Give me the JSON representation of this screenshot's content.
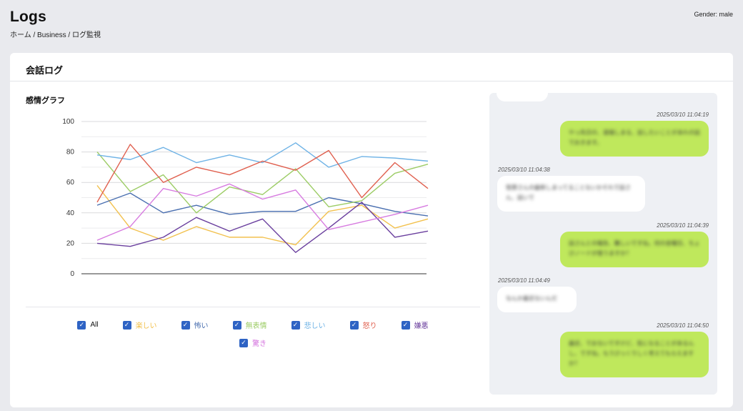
{
  "header": {
    "title": "Logs",
    "breadcrumb": "ホーム / Business / ログ監視",
    "gender": "Gender: male"
  },
  "card": {
    "title": "会話ログ",
    "chart_title": "感情グラフ"
  },
  "legend": {
    "all_label": "All",
    "items": [
      {
        "label": "楽しい",
        "color": "#f2c14e"
      },
      {
        "label": "怖い",
        "color": "#4a6fb0"
      },
      {
        "label": "無表情",
        "color": "#9ccc65"
      },
      {
        "label": "悲しい",
        "color": "#6fb3e6"
      },
      {
        "label": "怒り",
        "color": "#e0604f"
      },
      {
        "label": "嫌悪",
        "color": "#6a3f9e"
      },
      {
        "label": "驚き",
        "color": "#d77be0"
      }
    ]
  },
  "chart_data": {
    "type": "line",
    "x": [
      1,
      2,
      3,
      4,
      5,
      6,
      7,
      8,
      9,
      10,
      11,
      12
    ],
    "ylim": [
      0,
      100
    ],
    "yticks": [
      0,
      20,
      40,
      60,
      80,
      100
    ],
    "grid": true,
    "legend_position": "bottom",
    "series": [
      {
        "name": "楽しい",
        "color": "#f2c14e",
        "values": [
          58,
          30,
          22,
          31,
          24,
          24,
          19,
          41,
          45,
          30,
          36
        ]
      },
      {
        "name": "怖い",
        "color": "#4a6fb0",
        "values": [
          45,
          53,
          40,
          45,
          39,
          41,
          41,
          50,
          46,
          41,
          38
        ]
      },
      {
        "name": "無表情",
        "color": "#9ccc65",
        "values": [
          80,
          54,
          65,
          40,
          57,
          52,
          69,
          44,
          48,
          66,
          72
        ]
      },
      {
        "name": "悲しい",
        "color": "#6fb3e6",
        "values": [
          78,
          75,
          83,
          73,
          78,
          73,
          86,
          70,
          77,
          76,
          74
        ]
      },
      {
        "name": "怒り",
        "color": "#e0604f",
        "values": [
          47,
          85,
          60,
          70,
          65,
          74,
          68,
          81,
          50,
          73,
          56
        ]
      },
      {
        "name": "嫌悪",
        "color": "#6a3f9e",
        "values": [
          20,
          18,
          24,
          37,
          28,
          36,
          14,
          30,
          47,
          24,
          28
        ]
      },
      {
        "name": "驚き",
        "color": "#d77be0",
        "values": [
          22,
          31,
          56,
          51,
          59,
          49,
          55,
          29,
          34,
          39,
          45
        ]
      }
    ]
  },
  "chat": {
    "messages": [
      {
        "side": "me",
        "timestamp": "2025/03/10 11:04:19",
        "text": "やっ先日の、道端しまる、話したいことがあれの話でおきます。"
      },
      {
        "side": "them",
        "timestamp": "2025/03/10 11:04:38",
        "text": "笹原さんの最新しまってることないかそれで話さん、話いで"
      },
      {
        "side": "me",
        "timestamp": "2025/03/10 11:04:39",
        "text": "話さんとの報告、難しいですね。何の金曜日、ちょびノードが使うますか？"
      },
      {
        "side": "them",
        "timestamp": "2025/03/10 11:04:49",
        "text": "なんか最近ないんだ"
      },
      {
        "side": "me",
        "timestamp": "2025/03/10 11:04:50",
        "text": "最近、でおないですけど、気になることがあるんし、ですね。もうびっくりしく考えてもらえますか？"
      }
    ]
  }
}
